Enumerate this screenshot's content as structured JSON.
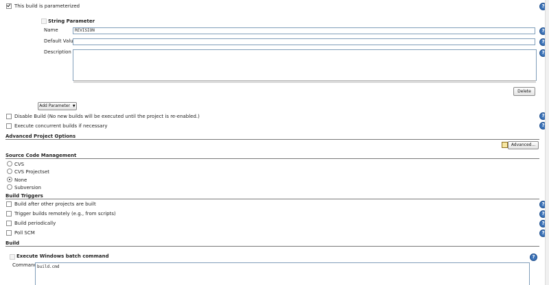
{
  "parameterized": {
    "label": "This build is parameterized",
    "checked": true
  },
  "string_parameter": {
    "title": "String Parameter",
    "name_label": "Name",
    "name_value": "REVISION",
    "default_label": "Default Value",
    "default_value": "",
    "description_label": "Description",
    "description_value": "",
    "delete_label": "Delete"
  },
  "add_parameter": {
    "label": "Add Parameter",
    "arrow": "▼"
  },
  "options": {
    "disable_build": "Disable Build (No new builds will be executed until the project is re-enabled.)",
    "concurrent": "Execute concurrent builds if necessary"
  },
  "advanced_project_options": {
    "title": "Advanced Project Options",
    "button": "Advanced..."
  },
  "scm": {
    "title": "Source Code Management",
    "options": [
      "CVS",
      "CVS Projectset",
      "None",
      "Subversion"
    ],
    "selected": "None"
  },
  "build_triggers": {
    "title": "Build Triggers",
    "items": [
      "Build after other projects are built",
      "Trigger builds remotely (e.g., from scripts)",
      "Build periodically",
      "Poll SCM"
    ]
  },
  "build": {
    "title": "Build",
    "step_title": "Execute Windows batch command",
    "command_label": "Command",
    "command_value": "build.cmd"
  },
  "help_icon_char": "?",
  "colors": {
    "help_blue": "#3c73b8",
    "input_border": "#7f9db9"
  }
}
